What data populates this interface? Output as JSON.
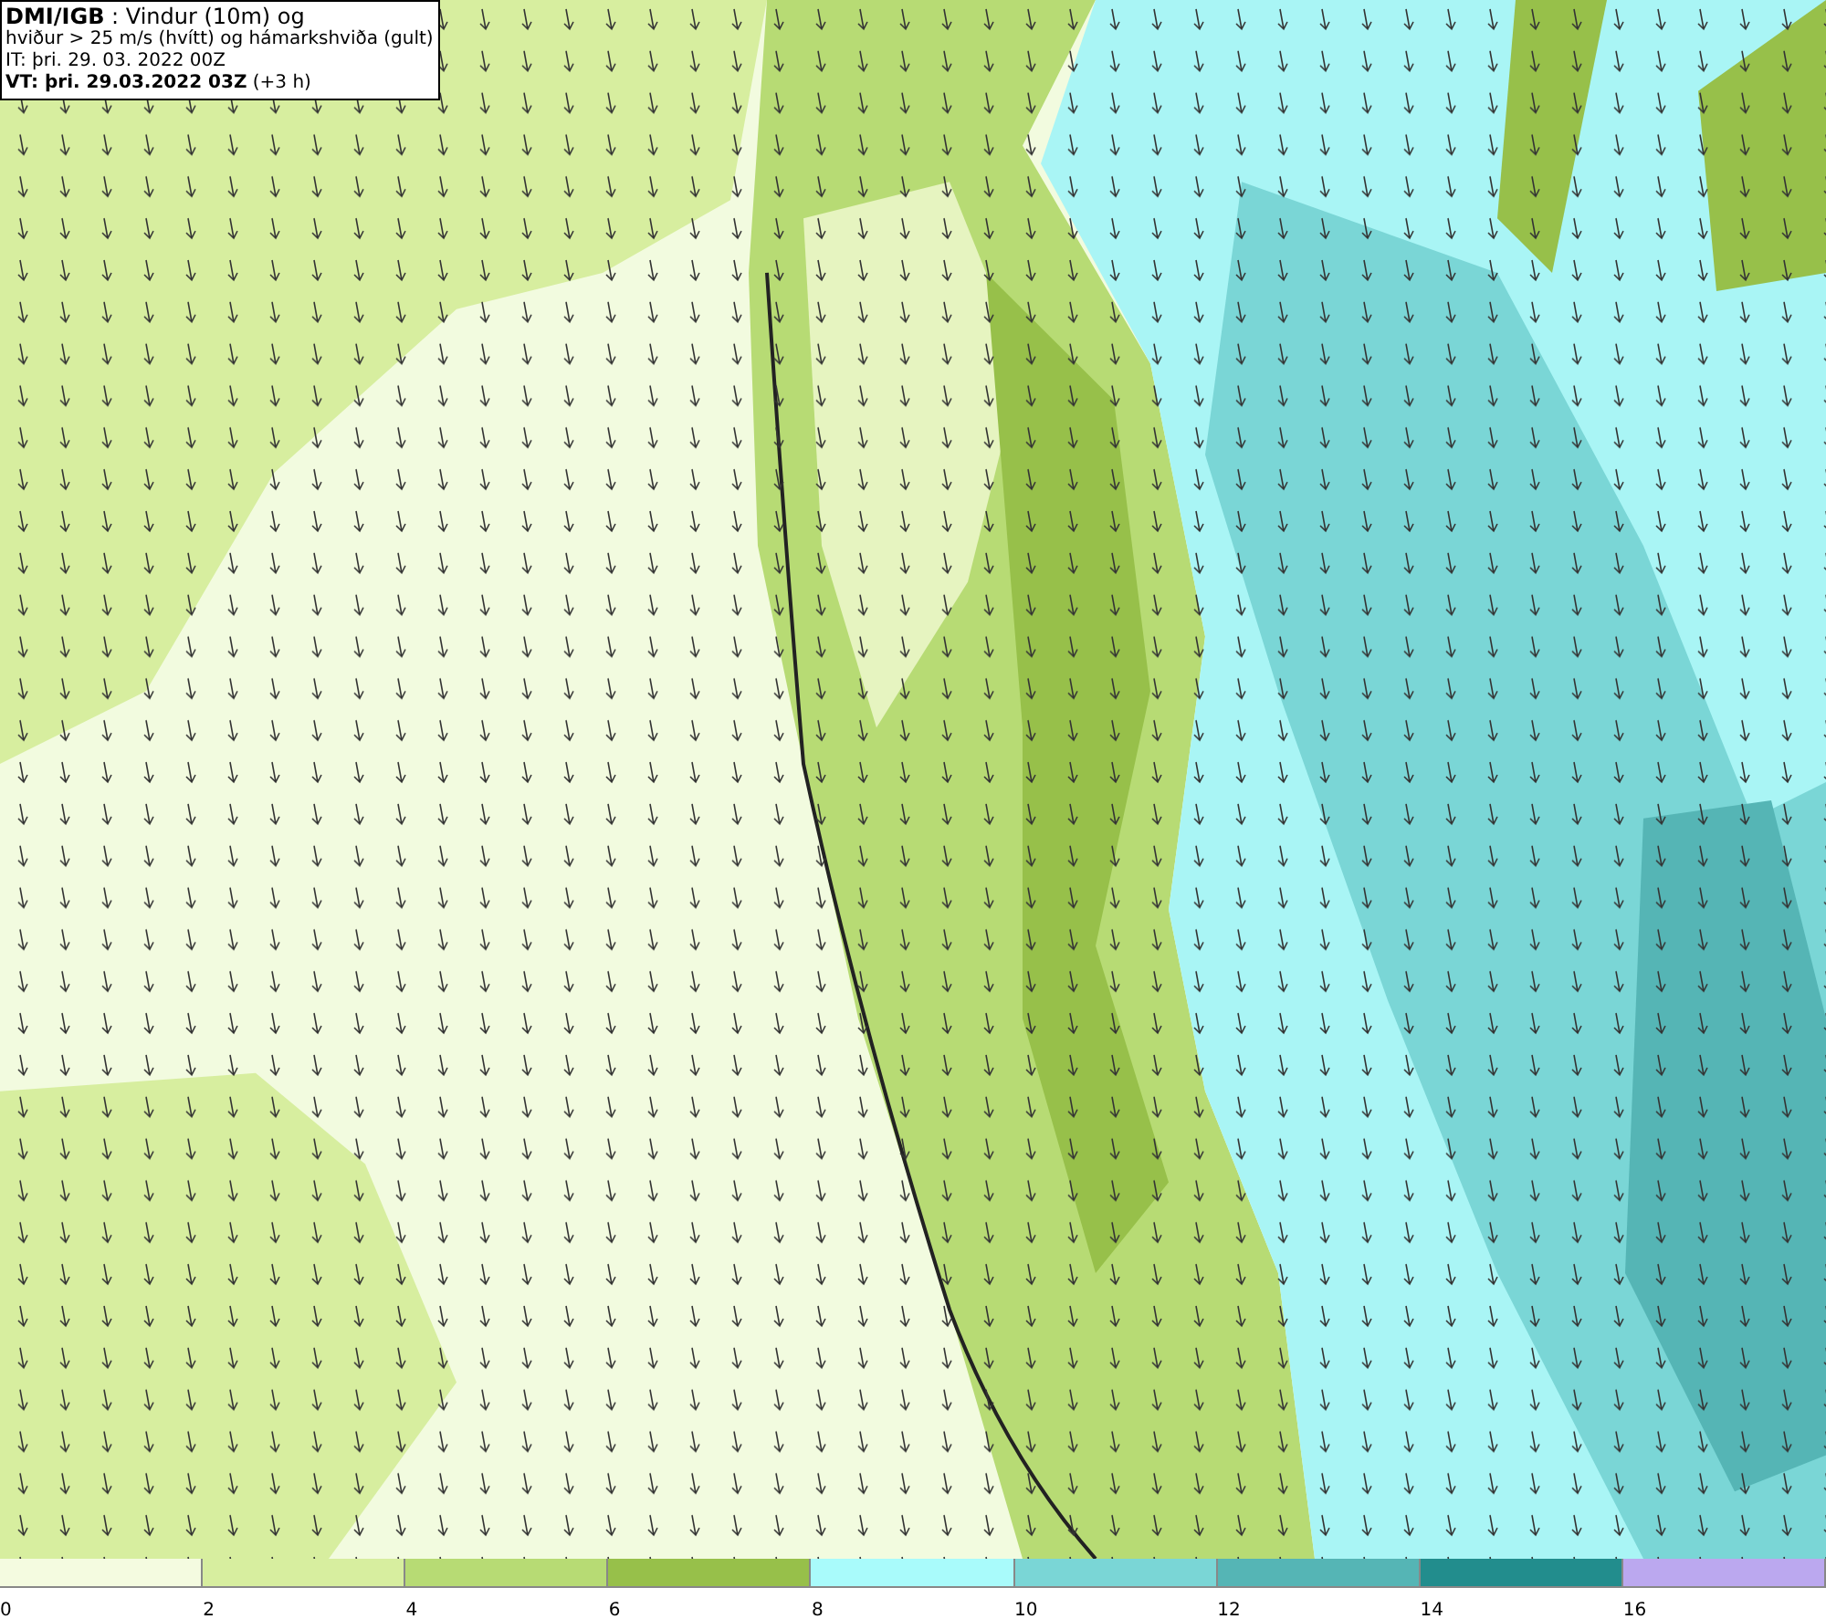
{
  "title_box": {
    "lines": [
      "**DMI/IGB** : Vindur (10m) og",
      "hviður > 25 m/s (hvítt) og hámarkshviða (gult)",
      "IT: þri. 29. 03. 2022 00Z",
      "**VT: þri. 29.03.2022 03Z** (+3 h)"
    ]
  },
  "legend": {
    "segments": [
      {
        "label": "0",
        "color": "#f4fbe0"
      },
      {
        "label": "2",
        "color": "#d7ee9f"
      },
      {
        "label": "4",
        "color": "#b7db74"
      },
      {
        "label": "6",
        "color": "#97c04a"
      },
      {
        "label": "8",
        "color": "#a9fbfb"
      },
      {
        "label": "10",
        "color": "#7ad6d6"
      },
      {
        "label": "12",
        "color": "#55b5b5"
      },
      {
        "label": "14",
        "color": "#228d8d"
      },
      {
        "label": "16",
        "color": "#bba8ef"
      }
    ]
  }
}
